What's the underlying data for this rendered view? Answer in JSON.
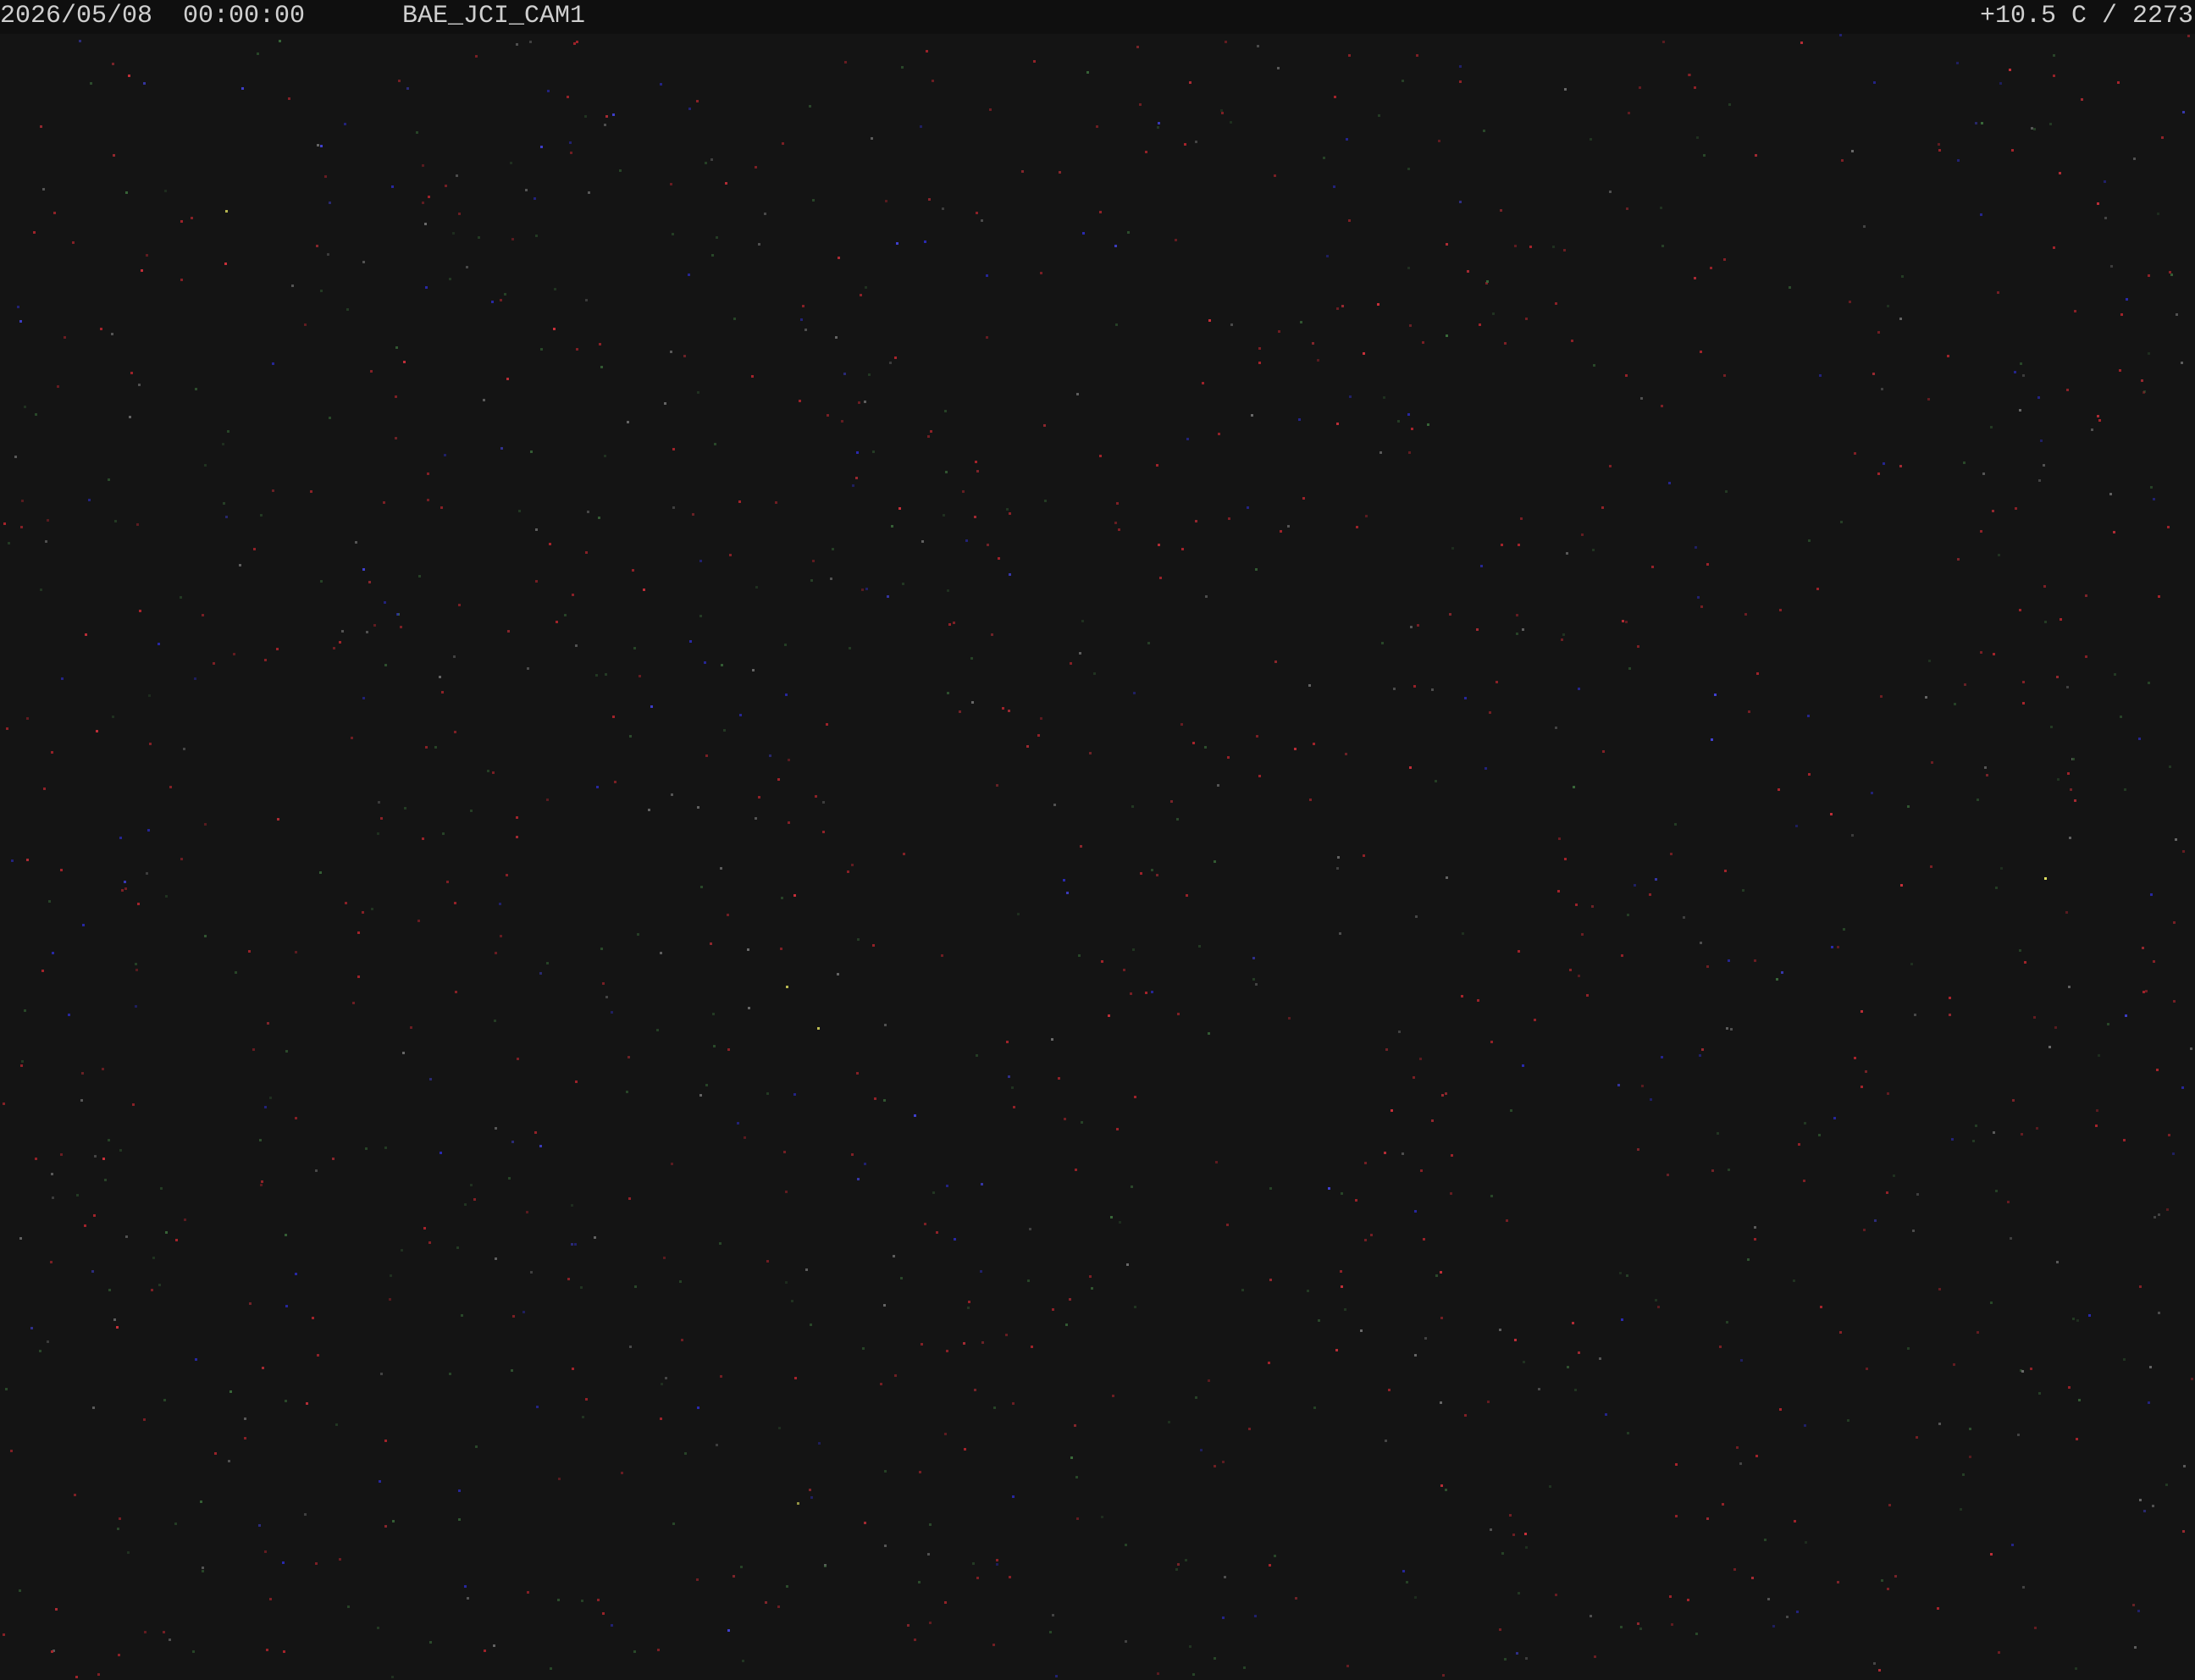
{
  "osd": {
    "datetime": "2026/05/08  00:00:00",
    "camera_name": "BAE_JCI_CAM1",
    "status": "+10.5 C / 2273"
  },
  "colors": {
    "sky": "#141414",
    "osd_bar": "#0f0f0f",
    "osd_text": "#cfcfcf",
    "noise_palette": [
      "#a8242c",
      "#c8303a",
      "#2a4a2a",
      "#3a6a3a",
      "#2a2ab0",
      "#4040d0",
      "#6a6a6a",
      "#e0e060"
    ]
  }
}
